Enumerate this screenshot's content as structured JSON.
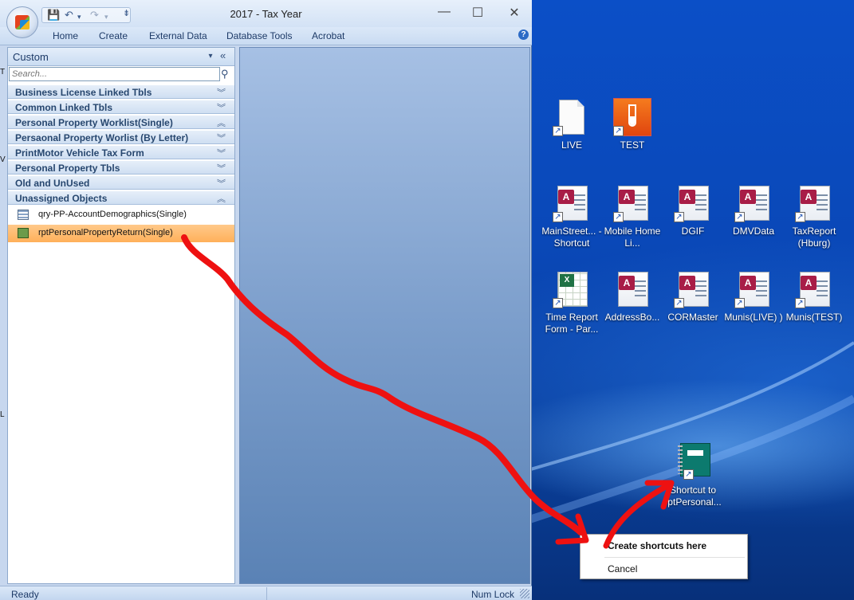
{
  "window": {
    "title": "2017 - Tax Year",
    "minimize": "—",
    "maximize": "☐",
    "close": "✕"
  },
  "qat": {
    "save": "💾",
    "undo": "↶",
    "redo": "↷",
    "dropdown": "▾",
    "customize": "⇟"
  },
  "ribbon": {
    "tabs": [
      "Home",
      "Create",
      "External Data",
      "Database Tools",
      "Acrobat"
    ],
    "help": "?"
  },
  "navpane": {
    "title": "Custom",
    "dropdown_glyph": "▾",
    "collapse_glyph": "«",
    "search_placeholder": "Search...",
    "search_icon": "⚲",
    "groups": [
      {
        "label": "Business License Linked Tbls",
        "chevron": "︾"
      },
      {
        "label": "Common Linked Tbls",
        "chevron": "︾"
      },
      {
        "label": "Personal Property Worklist(Single)",
        "chevron": "︽"
      },
      {
        "label": "Persaonal Property Worlist (By Letter)",
        "chevron": "︾"
      },
      {
        "label": "PrintMotor Vehicle Tax Form",
        "chevron": "︾"
      },
      {
        "label": "Personal Property Tbls",
        "chevron": "︾"
      },
      {
        "label": "Old and UnUsed",
        "chevron": "︾"
      },
      {
        "label": "Unassigned Objects",
        "chevron": "︽"
      }
    ],
    "items": [
      {
        "label": "qry-PP-AccountDemographics(Single)",
        "icon": "query-icon"
      },
      {
        "label": "rptPersonalPropertyReturn(Single)",
        "icon": "report-icon",
        "selected": true
      }
    ]
  },
  "statusbar": {
    "left": "Ready",
    "right": "Num Lock"
  },
  "desktop": {
    "icons": [
      {
        "label": "LIVE",
        "type": "file"
      },
      {
        "label": "TEST",
        "type": "test"
      },
      {
        "label": "MainStreet... - Shortcut",
        "type": "access"
      },
      {
        "label": "Mobile Home Li...",
        "type": "access"
      },
      {
        "label": "DGIF",
        "type": "access"
      },
      {
        "label": "DMVData",
        "type": "access"
      },
      {
        "label": "TaxReport (Hburg)",
        "type": "access"
      },
      {
        "label": "Time Report Form - Par...",
        "type": "excel"
      },
      {
        "label": "AddressBo...",
        "type": "access"
      },
      {
        "label": "CORMaster",
        "type": "access"
      },
      {
        "label": "Munis(LIVE) )",
        "type": "access"
      },
      {
        "label": "Munis(TEST)",
        "type": "access"
      },
      {
        "label": "Shortcut to rptPersonal...",
        "type": "notebook"
      }
    ],
    "shortcut_arrow": "↗"
  },
  "context_menu": {
    "items": [
      "Create shortcuts here",
      "Cancel"
    ]
  },
  "edge_chars": [
    "T",
    "V",
    "L"
  ],
  "colors": {
    "desktop": "#0b4fc7",
    "selection": "#ffb05a",
    "annotation": "#ee1111"
  }
}
